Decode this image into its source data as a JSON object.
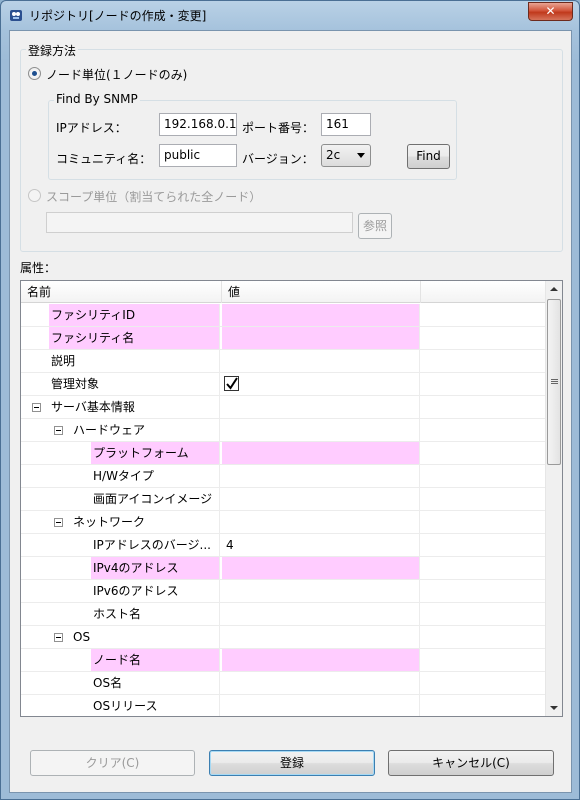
{
  "window": {
    "title": "リポジトリ[ノードの作成・変更]",
    "close_label": "✕"
  },
  "registration": {
    "group_label": "登録方法",
    "node_option_label": "ノード単位(１ノードのみ)",
    "scope_option_label": "スコープ単位（割当てられた全ノード）",
    "scope_value": "",
    "browse_button": "参照"
  },
  "snmp": {
    "group_label": "Find By SNMP",
    "ip_label": "IPアドレス：",
    "ip_value": "192.168.0.1",
    "port_label": "ポート番号：",
    "port_value": "161",
    "community_label": "コミュニティ名：",
    "community_value": "public",
    "version_label": "バージョン：",
    "version_value": "2c",
    "find_button": "Find"
  },
  "attributes": {
    "label": "属性：",
    "col_name": "名前",
    "col_value": "値",
    "rows": [
      {
        "name": "ファシリティID",
        "value": ""
      },
      {
        "name": "ファシリティ名",
        "value": ""
      },
      {
        "name": "説明",
        "value": ""
      },
      {
        "name": "管理対象",
        "value": ""
      },
      {
        "name": "サーバ基本情報",
        "value": ""
      },
      {
        "name": "ハードウェア",
        "value": ""
      },
      {
        "name": "プラットフォーム",
        "value": ""
      },
      {
        "name": "H/Wタイプ",
        "value": ""
      },
      {
        "name": "画面アイコンイメージ",
        "value": ""
      },
      {
        "name": "ネットワーク",
        "value": ""
      },
      {
        "name": "IPアドレスのバージ...",
        "value": "4"
      },
      {
        "name": "IPv4のアドレス",
        "value": ""
      },
      {
        "name": "IPv6のアドレス",
        "value": ""
      },
      {
        "name": "ホスト名",
        "value": ""
      },
      {
        "name": "OS",
        "value": ""
      },
      {
        "name": "ノード名",
        "value": ""
      },
      {
        "name": "OS名",
        "value": ""
      },
      {
        "name": "OSリリース",
        "value": ""
      }
    ]
  },
  "footer": {
    "clear_button": "クリア(C)",
    "register_button": "登録",
    "cancel_button": "キャンセル(C)"
  },
  "colors": {
    "required_highlight": "#ffccff",
    "window_frame": "#9dbbd7"
  },
  "icons": [
    "app-icon",
    "close-icon",
    "checkbox-checked-icon",
    "collapse-icon",
    "scroll-up-icon",
    "scroll-down-icon"
  ]
}
